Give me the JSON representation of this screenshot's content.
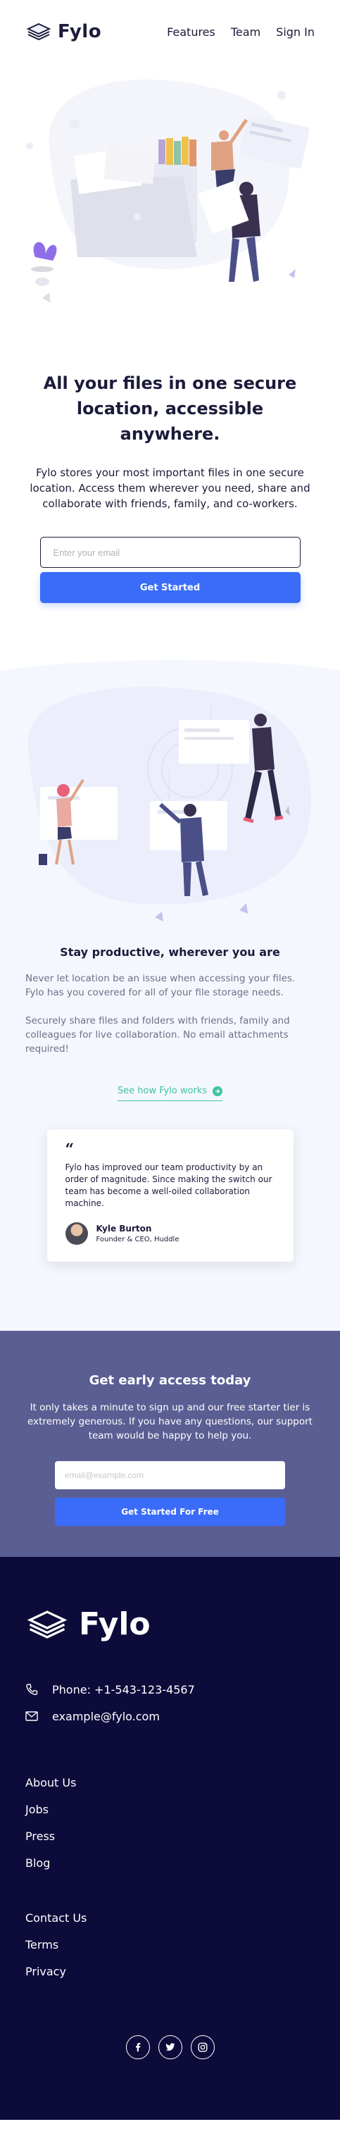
{
  "header": {
    "logo_text": "Fylo",
    "nav": [
      "Features",
      "Team",
      "Sign In"
    ]
  },
  "hero": {
    "title": "All your files in one secure location, accessible anywhere.",
    "description": "Fylo stores your most important files in one secure location. Access them wherever you need, share and collaborate with friends, family, and co-workers.",
    "email_placeholder": "Enter your email",
    "cta_label": "Get Started"
  },
  "productive": {
    "title": "Stay productive, wherever you are",
    "para1": "Never let location be an issue when accessing your files. Fylo has you covered for all of your file storage needs.",
    "para2": "Securely share files and folders with friends, family and colleagues for live collaboration. No email attachments required!",
    "link_label": "See how Fylo works"
  },
  "testimonial": {
    "quote_mark": "“",
    "text": "Fylo has improved our team productivity by an order of magnitude. Since making the switch our team has become a well-oiled collaboration machine.",
    "name": "Kyle Burton",
    "role": "Founder & CEO, Huddle"
  },
  "early_access": {
    "title": "Get early access today",
    "description": "It only takes a minute to sign up and our free starter tier is extremely generous. If you have any questions, our support team would be happy to help you.",
    "email_placeholder": "email@example.com",
    "cta_label": "Get Started For Free"
  },
  "footer": {
    "logo_text": "Fylo",
    "phone": "Phone:  +1-543-123-4567",
    "email": "example@fylo.com",
    "links_col1": [
      "About Us",
      "Jobs",
      "Press",
      "Blog"
    ],
    "links_col2": [
      "Contact Us",
      "Terms",
      "Privacy"
    ],
    "social_icons": [
      "facebook-icon",
      "twitter-icon",
      "instagram-icon"
    ]
  },
  "colors": {
    "accent": "#3a6cf9",
    "teal": "#3fc4a2",
    "early_bg": "#5b5e93",
    "footer_bg": "#0d0b3a",
    "light_bg": "#f5f7ff"
  }
}
